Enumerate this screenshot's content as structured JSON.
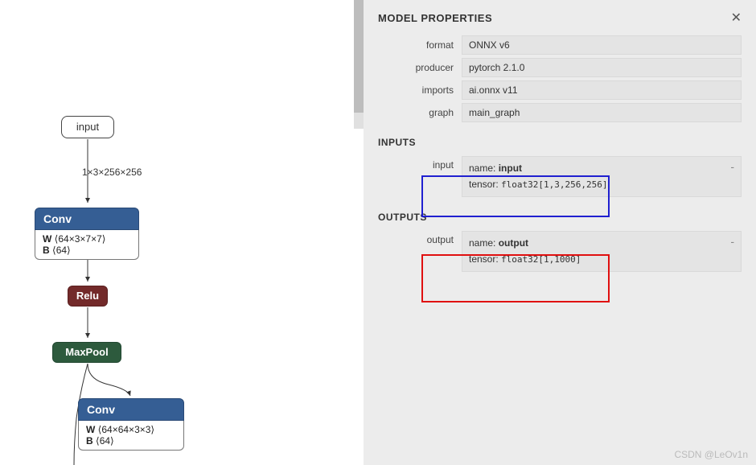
{
  "graph": {
    "input_node": "input",
    "edge_label_1": "1×3×256×256",
    "conv1": {
      "title": "Conv",
      "w_label": "W",
      "w_shape": "⟨64×3×7×7⟩",
      "b_label": "B",
      "b_shape": "⟨64⟩"
    },
    "relu": "Relu",
    "maxpool": "MaxPool",
    "conv2": {
      "title": "Conv",
      "w_label": "W",
      "w_shape": "⟨64×64×3×3⟩",
      "b_label": "B",
      "b_shape": "⟨64⟩"
    }
  },
  "panel": {
    "title": "MODEL PROPERTIES",
    "props": {
      "format_label": "format",
      "format_value": "ONNX v6",
      "producer_label": "producer",
      "producer_value": "pytorch 2.1.0",
      "imports_label": "imports",
      "imports_value": "ai.onnx v11",
      "graph_label": "graph",
      "graph_value": "main_graph"
    },
    "inputs_title": "INPUTS",
    "input": {
      "label": "input",
      "name_key": "name:",
      "name_value": "input",
      "tensor_key": "tensor:",
      "tensor_value": "float32[1,3,256,256]",
      "toggle": "-"
    },
    "outputs_title": "OUTPUTS",
    "output": {
      "label": "output",
      "name_key": "name:",
      "name_value": "output",
      "tensor_key": "tensor:",
      "tensor_value": "float32[1,1000]",
      "toggle": "-"
    }
  },
  "watermark": "CSDN @LeOv1n"
}
